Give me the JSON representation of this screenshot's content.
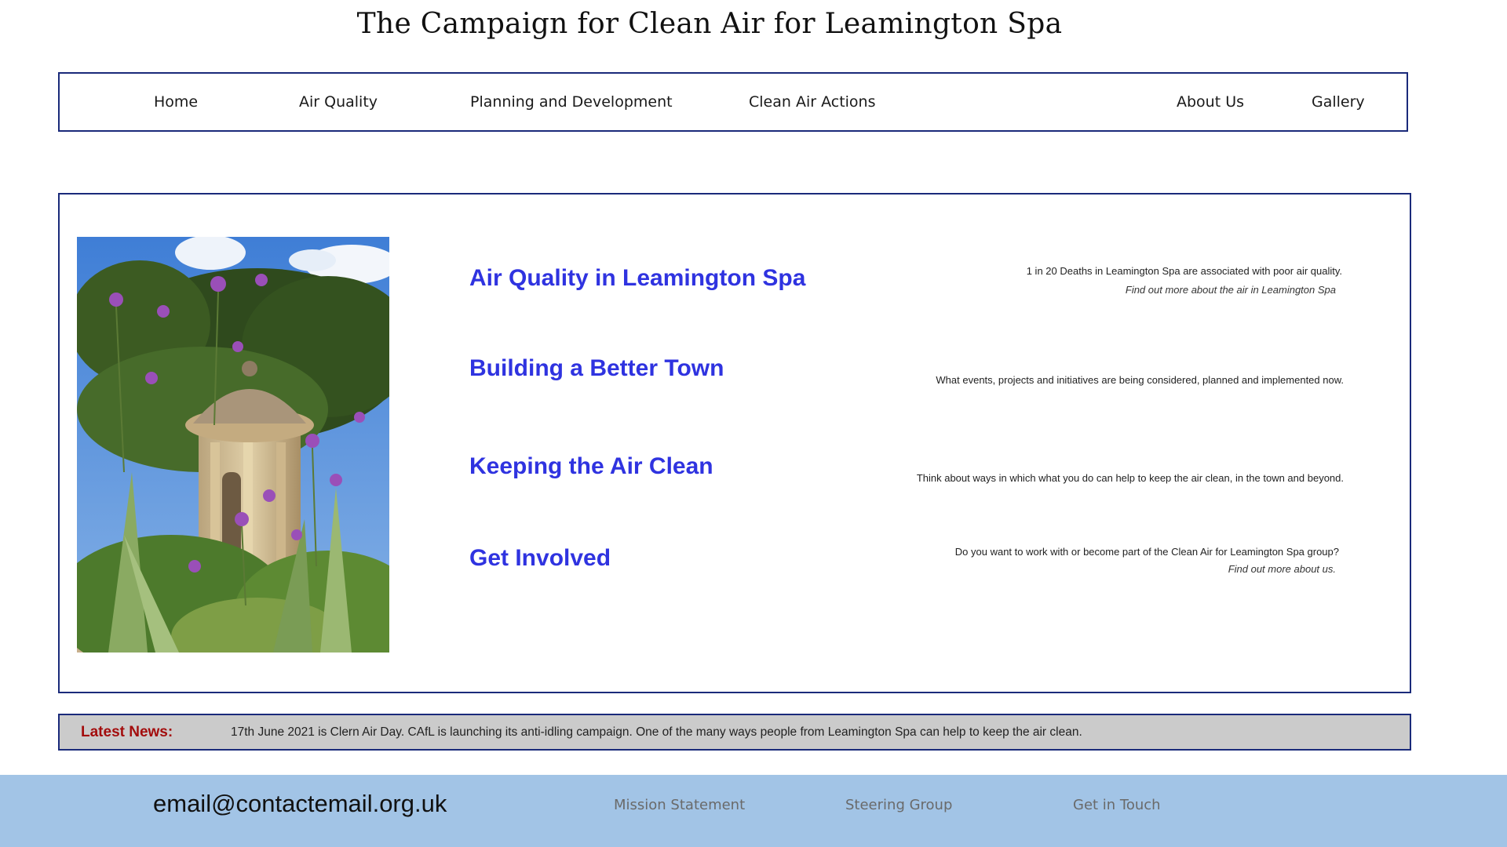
{
  "site": {
    "title": "The Campaign for Clean Air for Leamington Spa"
  },
  "nav": {
    "items": [
      {
        "label": "Home"
      },
      {
        "label": "Air Quality"
      },
      {
        "label": "Planning and Development"
      },
      {
        "label": "Clean Air Actions"
      },
      {
        "label": "About Us"
      },
      {
        "label": "Gallery"
      }
    ]
  },
  "main": {
    "photo": {
      "icon": "garden-rotunda-photo"
    },
    "sections": [
      {
        "title": "Air Quality in Leamington Spa",
        "description": "1 in 20 Deaths in Leamington Spa are associated with poor air quality.",
        "more": "Find out more about the air in Leamington Spa"
      },
      {
        "title": "Building a Better Town",
        "description": "What events, projects and initiatives are being considered, planned and implemented now."
      },
      {
        "title": "Keeping the Air Clean",
        "description": "Think about ways in which what you do can help to keep the air clean, in the town and beyond."
      },
      {
        "title": "Get Involved",
        "description": "Do you want to work with or become part of the Clean Air for Leamington Spa group?",
        "more": "Find out more about us."
      }
    ]
  },
  "news": {
    "label": "Latest News:",
    "text": "17th June 2021 is Clern Air Day.  CAfL is launching its anti-idling campaign.  One of the many ways people from Leamington Spa can help to keep the air clean."
  },
  "footer": {
    "email": "email@contactemail.org.uk",
    "links": [
      {
        "label": "Mission Statement"
      },
      {
        "label": "Steering Group"
      },
      {
        "label": "Get in Touch"
      }
    ]
  },
  "colors": {
    "border": "#1a2a7a",
    "section_link": "#2f33e0",
    "news_label": "#a30d0d",
    "news_background": "#cbcbcb",
    "footer_background": "#a2c4e6"
  }
}
